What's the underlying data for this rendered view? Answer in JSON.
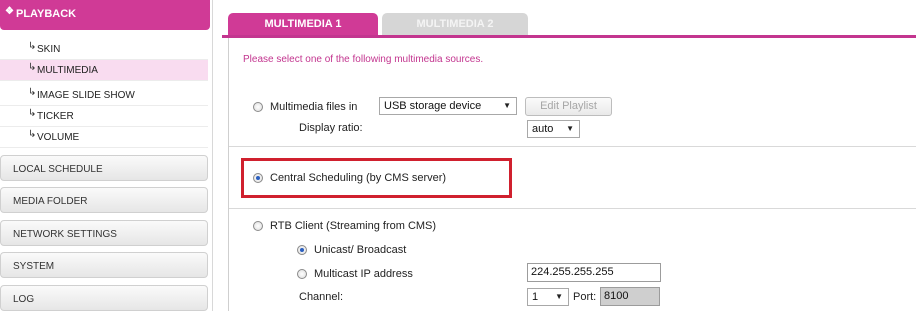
{
  "sidebar": {
    "header": "PLAYBACK",
    "header_icon": "tree-expand-icon",
    "sub_items": [
      {
        "label": "SKIN"
      },
      {
        "label": "MULTIMEDIA",
        "active": true
      },
      {
        "label": "IMAGE SLIDE SHOW"
      },
      {
        "label": "TICKER"
      },
      {
        "label": "VOLUME"
      }
    ],
    "sections": [
      "LOCAL SCHEDULE",
      "MEDIA FOLDER",
      "NETWORK SETTINGS",
      "SYSTEM",
      "LOG"
    ]
  },
  "tabs": [
    {
      "label": "MULTIMEDIA 1",
      "active": true
    },
    {
      "label": "MULTIMEDIA 2",
      "active": false
    }
  ],
  "main": {
    "intro": "Please select one of the following multimedia sources.",
    "multimedia_files": {
      "label": "Multimedia files in",
      "source_select": "USB storage device",
      "edit_playlist": "Edit Playlist",
      "display_ratio_label": "Display ratio:",
      "display_ratio_value": "auto",
      "selected": false
    },
    "central_scheduling": {
      "label": "Central Scheduling (by CMS server)",
      "selected": true
    },
    "rtb_client": {
      "label": "RTB Client (Streaming from CMS)",
      "selected": false,
      "unicast_label": "Unicast/ Broadcast",
      "unicast_selected": true,
      "multicast_label": "Multicast IP address",
      "multicast_ip": "224.255.255.255",
      "channel_label": "Channel:",
      "channel_value": "1",
      "port_label": "Port:",
      "port_value": "8100"
    }
  },
  "colors": {
    "accent": "#d03a96",
    "active_item_bg": "#f9dcf0",
    "highlight_box": "#d0202e",
    "radio_dot": "#2b5fbf"
  }
}
